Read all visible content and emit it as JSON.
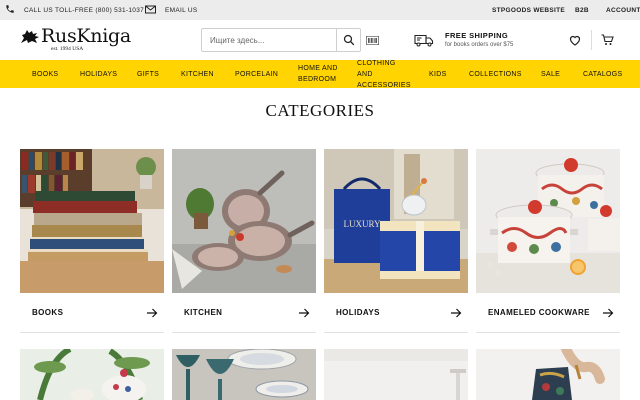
{
  "topbar": {
    "phone_label": "CALL US TOLL-FREE (800) 531-1037",
    "email_label": "EMAIL US",
    "links": [
      "STPGOODS WEBSITE",
      "B2B",
      "ACCOUNT"
    ]
  },
  "header": {
    "logo_name": "RusKniga",
    "logo_tagline": "est. 1994 USA",
    "search_placeholder": "Ищите здесь...",
    "shipping_title": "FREE SHIPPING",
    "shipping_subtitle": "for books orders over $75"
  },
  "nav": {
    "items": [
      "BOOKS",
      "HOLIDAYS",
      "GIFTS",
      "KITCHEN",
      "PORCELAIN",
      "HOME AND BEDROOM",
      "CLOTHING AND ACCESSORIES",
      "KIDS",
      "COLLECTIONS",
      "SALE",
      "CATALOGS"
    ]
  },
  "categories": {
    "title": "CATEGORIES",
    "cards": [
      {
        "label": "BOOKS"
      },
      {
        "label": "KITCHEN"
      },
      {
        "label": "HOLIDAYS"
      },
      {
        "label": "ENAMELED COOKWARE"
      }
    ]
  },
  "illustrations": {
    "holidays_box_text": "LUXURY"
  },
  "colors": {
    "accent_yellow": "#ffd400",
    "topbar_gray": "#ececec",
    "text_dark": "#111111"
  },
  "icons": [
    "phone-icon",
    "email-icon",
    "search-icon",
    "barcode-icon",
    "truck-icon",
    "heart-icon",
    "cart-icon",
    "arrow-right-icon"
  ]
}
